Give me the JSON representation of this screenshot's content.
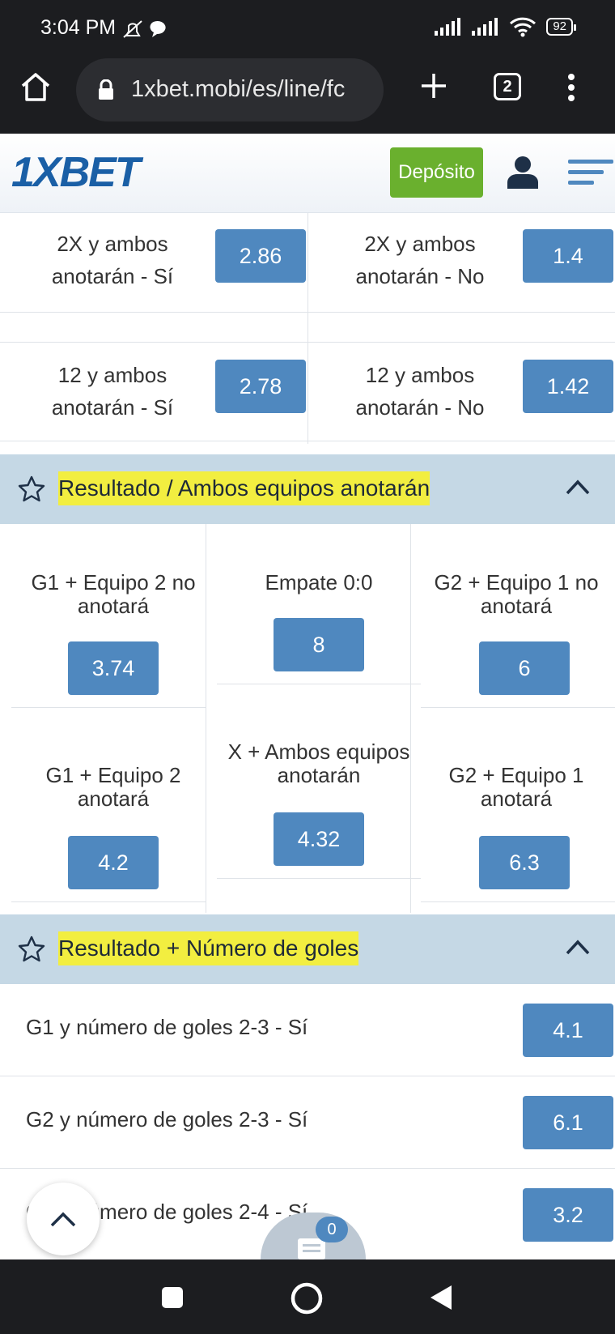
{
  "status": {
    "time": "3:04 PM",
    "battery": "92"
  },
  "browser": {
    "url": "1xbet.mobi/es/line/fc",
    "tab_count": "2"
  },
  "site": {
    "logo": "1XBET",
    "deposit_label": "Depósito"
  },
  "pairs": [
    {
      "left_label": "2X y ambos anotarán - Sí",
      "left_odd": "2.86",
      "right_label": "2X y ambos anotarán - No",
      "right_odd": "1.4"
    },
    {
      "left_label": "12 y ambos anotarán - Sí",
      "left_odd": "2.78",
      "right_label": "12 y ambos anotarán - No",
      "right_odd": "1.42"
    }
  ],
  "section1": {
    "title": "Resultado / Ambos equipos anotarán",
    "cells": [
      {
        "label": "G1 + Equipo 2 no anotará",
        "odd": "3.74"
      },
      {
        "label": "Empate 0:0",
        "odd": "8"
      },
      {
        "label": "G2 + Equipo 1 no anotará",
        "odd": "6"
      },
      {
        "label": "G1 + Equipo 2 anotará",
        "odd": "4.2"
      },
      {
        "label": "X + Ambos equipos anotarán",
        "odd": "4.32"
      },
      {
        "label": "G2 + Equipo 1 anotará",
        "odd": "6.3"
      }
    ]
  },
  "section2": {
    "title": "Resultado + Número de goles",
    "rows": [
      {
        "label": "G1 y número de goles 2-3 - Sí",
        "odd": "4.1"
      },
      {
        "label": "G2 y número de goles 2-3 - Sí",
        "odd": "6.1"
      },
      {
        "label": "G1 y número de goles 2-4 - Sí",
        "odd": "3.2"
      }
    ]
  },
  "betslip": {
    "count": "0"
  }
}
